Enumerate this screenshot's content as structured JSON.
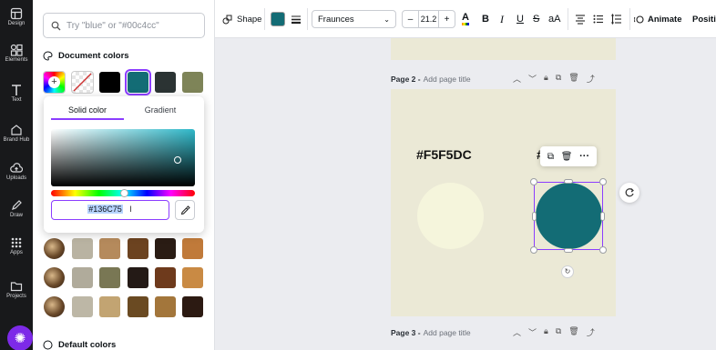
{
  "rail": {
    "items": [
      {
        "label": "Design",
        "icon": "layout-icon"
      },
      {
        "label": "Elements",
        "icon": "shapes-icon"
      },
      {
        "label": "Text",
        "icon": "text-icon"
      },
      {
        "label": "Brand Hub",
        "icon": "brand-icon"
      },
      {
        "label": "Uploads",
        "icon": "cloud-upload-icon"
      },
      {
        "label": "Draw",
        "icon": "pen-icon"
      },
      {
        "label": "Apps",
        "icon": "grid-icon"
      },
      {
        "label": "Projects",
        "icon": "folder-icon"
      }
    ]
  },
  "panel": {
    "search_placeholder": "Try \"blue\" or \"#00c4cc\"",
    "document_colors_title": "Document colors",
    "document_colors": [
      "#000000",
      "#136c75",
      "#2b3333",
      "#7e8458"
    ],
    "default_colors_title": "Default colors",
    "photo_color_rows": [
      [
        "#b9b3a2",
        "#b58a5c",
        "#6c4320",
        "#2a1c14",
        "#c07a3a"
      ],
      [
        "#b0ab9b",
        "#797754",
        "#241a16",
        "#6e3a1c",
        "#c98a44"
      ],
      [
        "#bdb7a6",
        "#c2a472",
        "#6a4a22",
        "#a3763b",
        "#2c1a12"
      ]
    ]
  },
  "picker": {
    "tab_solid": "Solid color",
    "tab_gradient": "Gradient",
    "hex_value": "#136C75"
  },
  "toolbar": {
    "shape_label": "Shape",
    "fill_color": "#136c75",
    "font_name": "Fraunces",
    "font_size": "21.2",
    "decrease_label": "–",
    "increase_label": "+",
    "animate_label": "Animate",
    "position_label": "Positio"
  },
  "canvas": {
    "page2_name": "Page 2 -",
    "page2_add": "Add page title",
    "page3_name": "Page 3 -",
    "page3_add": "Add page title",
    "hex_text_left": "#F5F5DC",
    "hex_text_right": "#",
    "cream_color": "#f5f5dc",
    "teal_color": "#136c75",
    "page_bg": "#ebe9d6"
  }
}
